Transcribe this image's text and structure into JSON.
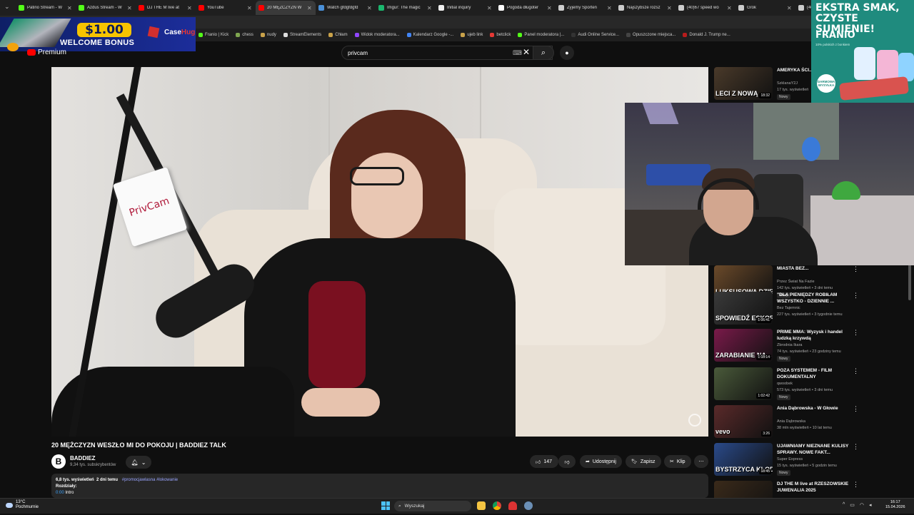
{
  "browser": {
    "tabs": [
      {
        "label": "Patino Stream - W",
        "color": "#53fc18",
        "active": false
      },
      {
        "label": "Azdus Stream - W",
        "color": "#53fc18",
        "active": false
      },
      {
        "label": "DJ THE M live at",
        "color": "#ff0000",
        "active": false
      },
      {
        "label": "YouTube",
        "color": "#ff0000",
        "active": false
      },
      {
        "label": "20 MĘŻCZYZN W",
        "color": "#ff0000",
        "active": true
      },
      {
        "label": "Watch gfdgfdgfd",
        "color": "#4a90d9",
        "active": false
      },
      {
        "label": "Imgur: The magic",
        "color": "#1bb76e",
        "active": false
      },
      {
        "label": "Initial inquiry",
        "color": "#eeeeee",
        "active": false
      },
      {
        "label": "Pogoda długoter",
        "color": "#ffffff",
        "active": false
      },
      {
        "label": "Żyjemy Sporten",
        "color": "#cccccc",
        "active": false
      },
      {
        "label": "Najszybsze rozsz",
        "color": "#cccccc",
        "active": false
      },
      {
        "label": "(40)67 speed wo",
        "color": "#cccccc",
        "active": false
      },
      {
        "label": "Grok",
        "color": "#cccccc",
        "active": false
      },
      {
        "label": "(40)#gbs #y",
        "color": "#cccccc",
        "active": false
      }
    ],
    "bookmarks": [
      {
        "label": "Franio | Kick",
        "color": "#53fc18"
      },
      {
        "label": "chess",
        "color": "#7fa650"
      },
      {
        "label": "nudy",
        "color": "#c9a24a"
      },
      {
        "label": "StreamElements",
        "color": "#dddddd"
      },
      {
        "label": "Chłam",
        "color": "#c9a24a"
      },
      {
        "label": "Widok moderatora...",
        "color": "#9146ff"
      },
      {
        "label": "Kalendarz Google -...",
        "color": "#4285f4"
      },
      {
        "label": "ujeb link",
        "color": "#c9a24a"
      },
      {
        "label": "betclick",
        "color": "#e53935"
      },
      {
        "label": "Panel moderatora |...",
        "color": "#53fc18"
      },
      {
        "label": "Audi Online Service...",
        "color": "#333333"
      },
      {
        "label": "Opuszczone miejsca...",
        "color": "#444444"
      },
      {
        "label": "Donald J. Trump ne...",
        "color": "#b71c1c"
      }
    ]
  },
  "ad_banner": {
    "price": "$1.00",
    "text": "WELCOME BONUS",
    "brand_a": "Case",
    "brand_b": "Hug"
  },
  "youtube": {
    "logo_text": "Premium",
    "search": {
      "value": "privcam"
    },
    "player": {
      "mic_flag_text": "PrivCam"
    },
    "video": {
      "title": "20 MĘŻCZYZN WESZŁO MI DO POKOJU | BADDIEZ TALK",
      "channel": "BADDIEZ",
      "channel_initial": "B",
      "subscribers": "9,34 tys. subskrybentów",
      "likes": "147",
      "share_label": "Udostępnij",
      "save_label": "Zapisz",
      "clip_label": "Klip",
      "views": "6,8 tys. wyświetleń",
      "age": "2 dni temu",
      "hashtags": "#promocjawlasna #lokowanie",
      "chapters_label": "Rozdziały:",
      "chapter_time": "0:00",
      "chapter_name": "Intro"
    }
  },
  "sidebar": {
    "items": [
      {
        "title": "AMERYKA ŚCI... TREND! MAMM...",
        "channel": "SzklanaY2J",
        "meta": "17 tys. wyświetleń",
        "badge": "Nowy",
        "duration": "18:32",
        "caption": "LECI Z NOWĄ",
        "thumb": "#4a3a2a"
      },
      {
        "title": "MIASTA BEZ...",
        "channel": "Przez Świat Na Fazie",
        "meta": "142 tys. wyświetleń • 3 dni temu",
        "badge": "Nowy",
        "duration": "27:37",
        "caption": "LUKSUSOWA DZIELNICA BRAKU",
        "thumb": "#6b4a2a"
      },
      {
        "title": "\"DLA PIENIĘDZY ROBIŁAM WSZYSTKO - DZIENNIE ...",
        "channel": "Bez Tajemnic",
        "meta": "227 tys. wyświetleń • 3 tygodnie temu",
        "badge": "",
        "duration": "1:06:41",
        "caption": "SPOWIEDŹ ESKORTKI",
        "thumb": "#3a3a3a"
      },
      {
        "title": "PRIME MMA: Wyzysk i handel ludzką krzywdą",
        "channel": "Zbrodnia Ikara",
        "meta": "74 tys. wyświetleń • 23 godziny temu",
        "badge": "Nowy",
        "duration": "1:18:14",
        "caption": "ZARABIANIE NA...",
        "thumb": "#7a1a4a"
      },
      {
        "title": "POZA SYSTEMEM - FILM DOKUMENTALNY",
        "channel": "qwoobek",
        "meta": "573 tys. wyświetleń • 3 dni temu",
        "badge": "Nowy",
        "duration": "1:02:42",
        "caption": "",
        "thumb": "#4a5a3a"
      },
      {
        "title": "Ania Dąbrowska - W Głowie",
        "channel": "Ania Dąbrowska",
        "meta": "38 mln wyświetleń • 10 lat temu",
        "badge": "",
        "duration": "3:26",
        "caption": "vevo",
        "thumb": "#5a2a2a"
      },
      {
        "title": "UJAWNIAMY NIEZNANE KULISY SPRAWY. NOWE FAKT...",
        "channel": "Super Express",
        "meta": "15 tys. wyświetleń • 5 godzin temu",
        "badge": "Nowy",
        "duration": "18:45",
        "caption": "BYSTRZYCA KŁOD...",
        "thumb": "#2a4a8a"
      },
      {
        "title": "DJ THE M live at RZESZOWSKIE JUWENALIA 2025",
        "channel": "",
        "meta": "",
        "badge": "",
        "duration": "",
        "caption": "",
        "thumb": "#3a2a1a"
      }
    ]
  },
  "promo": {
    "headline": "EKSTRA SMAK, CZYSTE SUMIENIE!",
    "brand": "FRANIO",
    "fineprint": "10% polskich z bonkiem",
    "badge": "DARMOWA WYSYŁKA"
  },
  "taskbar": {
    "temp": "13°C",
    "weather": "Pochmurnie",
    "search_placeholder": "Wyszukaj",
    "time": "16:17",
    "date": "15.04.2026"
  }
}
